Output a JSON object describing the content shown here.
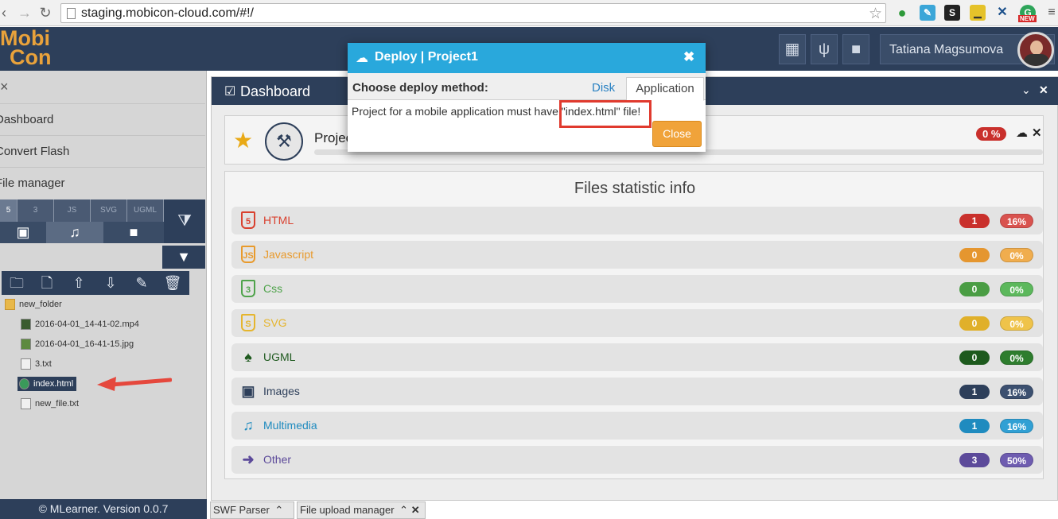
{
  "browser": {
    "url": "staging.mobicon-cloud.com/#!/",
    "back_icon": "back-arrow-icon",
    "forward_icon": "forward-arrow-icon",
    "reload_icon": "reload-icon",
    "new_badge": "NEW"
  },
  "app": {
    "logo_line1": "Mobi",
    "logo_line2": "Con",
    "user_name": "Tatiana Magsumova"
  },
  "sidebar": {
    "items": [
      {
        "label": "Dashboard"
      },
      {
        "label": "Convert Flash"
      },
      {
        "label": "File manager"
      }
    ],
    "filter_tabs": [
      "html5",
      "css3",
      "js",
      "svg",
      "ugml"
    ],
    "filter_tabs_row2": [
      "image",
      "music",
      "video"
    ],
    "tree": [
      {
        "name": "new_folder",
        "type": "folder"
      },
      {
        "name": "2016-04-01_14-41-02.mp4",
        "type": "video"
      },
      {
        "name": "2016-04-01_16-41-15.jpg",
        "type": "image"
      },
      {
        "name": "3.txt",
        "type": "text"
      },
      {
        "name": "index.html",
        "type": "html",
        "selected": true
      },
      {
        "name": "new_file.txt",
        "type": "text"
      }
    ],
    "footer": "© MLearner. Version 0.0.7"
  },
  "dashboard": {
    "title": "Dashboard",
    "project": {
      "name": "Project1",
      "progress_label": "0 %",
      "progress_value": 0
    },
    "stats_title": "Files statistic info",
    "stats": [
      {
        "label": "HTML",
        "count": "1",
        "pct": "16%",
        "color": "#d9412f",
        "count_color": "#c9302c",
        "pct_color": "#d9534f",
        "icon": "5"
      },
      {
        "label": "Javascript",
        "count": "0",
        "pct": "0%",
        "color": "#e89a2c",
        "count_color": "#e5962f",
        "pct_color": "#f0ad4e",
        "icon": "JS"
      },
      {
        "label": "Css",
        "count": "0",
        "pct": "0%",
        "color": "#4fa34b",
        "count_color": "#4a9d44",
        "pct_color": "#5cb85c",
        "icon": "3"
      },
      {
        "label": "SVG",
        "count": "0",
        "pct": "0%",
        "color": "#e5b52e",
        "count_color": "#e0b02a",
        "pct_color": "#efc34a",
        "icon": "S"
      },
      {
        "label": "UGML",
        "count": "0",
        "pct": "0%",
        "color": "#1f5a1f",
        "count_color": "#1d5a1d",
        "pct_color": "#2e7d2e",
        "icon": "U"
      },
      {
        "label": "Images",
        "count": "1",
        "pct": "16%",
        "color": "#2d3f5a",
        "count_color": "#2d3f5a",
        "pct_color": "#3c5070",
        "icon": "img"
      },
      {
        "label": "Multimedia",
        "count": "1",
        "pct": "16%",
        "color": "#1f8bbf",
        "count_color": "#1f8bbf",
        "pct_color": "#31a0d4",
        "icon": "mus"
      },
      {
        "label": "Other",
        "count": "3",
        "pct": "50%",
        "color": "#5c4a9a",
        "count_color": "#5c4a9a",
        "pct_color": "#6e5cb0",
        "icon": "arr"
      }
    ]
  },
  "bottom_tabs": [
    {
      "label": "SWF Parser"
    },
    {
      "label": "File upload manager"
    }
  ],
  "modal": {
    "title": "Deploy | Project1",
    "method_label": "Choose deploy method:",
    "tab_disk": "Disk",
    "tab_application": "Application",
    "message": "Project for a mobile application must have \"index.html\" file!",
    "close_label": "Close"
  }
}
